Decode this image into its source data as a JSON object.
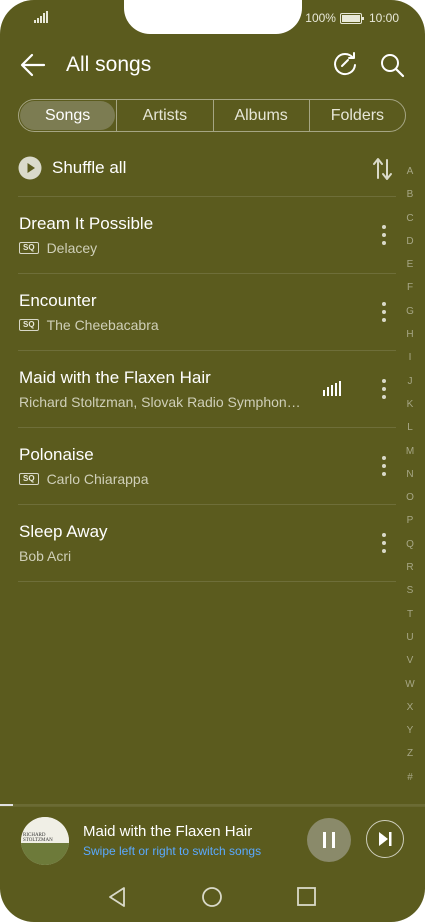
{
  "status_bar": {
    "battery_percent": "100%",
    "time": "10:00"
  },
  "header": {
    "title": "All songs"
  },
  "tabs": [
    {
      "label": "Songs",
      "active": true
    },
    {
      "label": "Artists",
      "active": false
    },
    {
      "label": "Albums",
      "active": false
    },
    {
      "label": "Folders",
      "active": false
    }
  ],
  "shuffle": {
    "label": "Shuffle all"
  },
  "songs": [
    {
      "title": "Dream It Possible",
      "artist": "Delacey",
      "quality_badge": "SQ"
    },
    {
      "title": "Encounter",
      "artist": "The Cheebacabra",
      "quality_badge": "SQ"
    },
    {
      "title": "Maid with the Flaxen Hair",
      "artist": "Richard Stoltzman, Slovak Radio Symphon…",
      "playing": true
    },
    {
      "title": "Polonaise",
      "artist": "Carlo Chiarappa",
      "quality_badge": "SQ"
    },
    {
      "title": "Sleep Away",
      "artist": "Bob Acri"
    }
  ],
  "alphabet_index": [
    "A",
    "B",
    "C",
    "D",
    "E",
    "F",
    "G",
    "H",
    "I",
    "J",
    "K",
    "L",
    "M",
    "N",
    "O",
    "P",
    "Q",
    "R",
    "S",
    "T",
    "U",
    "V",
    "W",
    "X",
    "Y",
    "Z",
    "#"
  ],
  "now_playing": {
    "title": "Maid with the Flaxen Hair",
    "hint": "Swipe left or right to switch songs",
    "album_art_text": "RICHARD STOLTZMAN",
    "progress_fraction": 0.03
  },
  "colors": {
    "background": "#5b5b1e",
    "accent_hint": "#5aa9ff",
    "active_tab": "#7c7c52"
  },
  "icons": {
    "back": "back-arrow-icon",
    "refresh": "refresh-icon",
    "search": "search-icon",
    "shuffle": "play-circle-icon",
    "sort": "sort-icon",
    "more": "more-vertical-icon",
    "pause": "pause-icon",
    "next": "skip-next-icon"
  }
}
